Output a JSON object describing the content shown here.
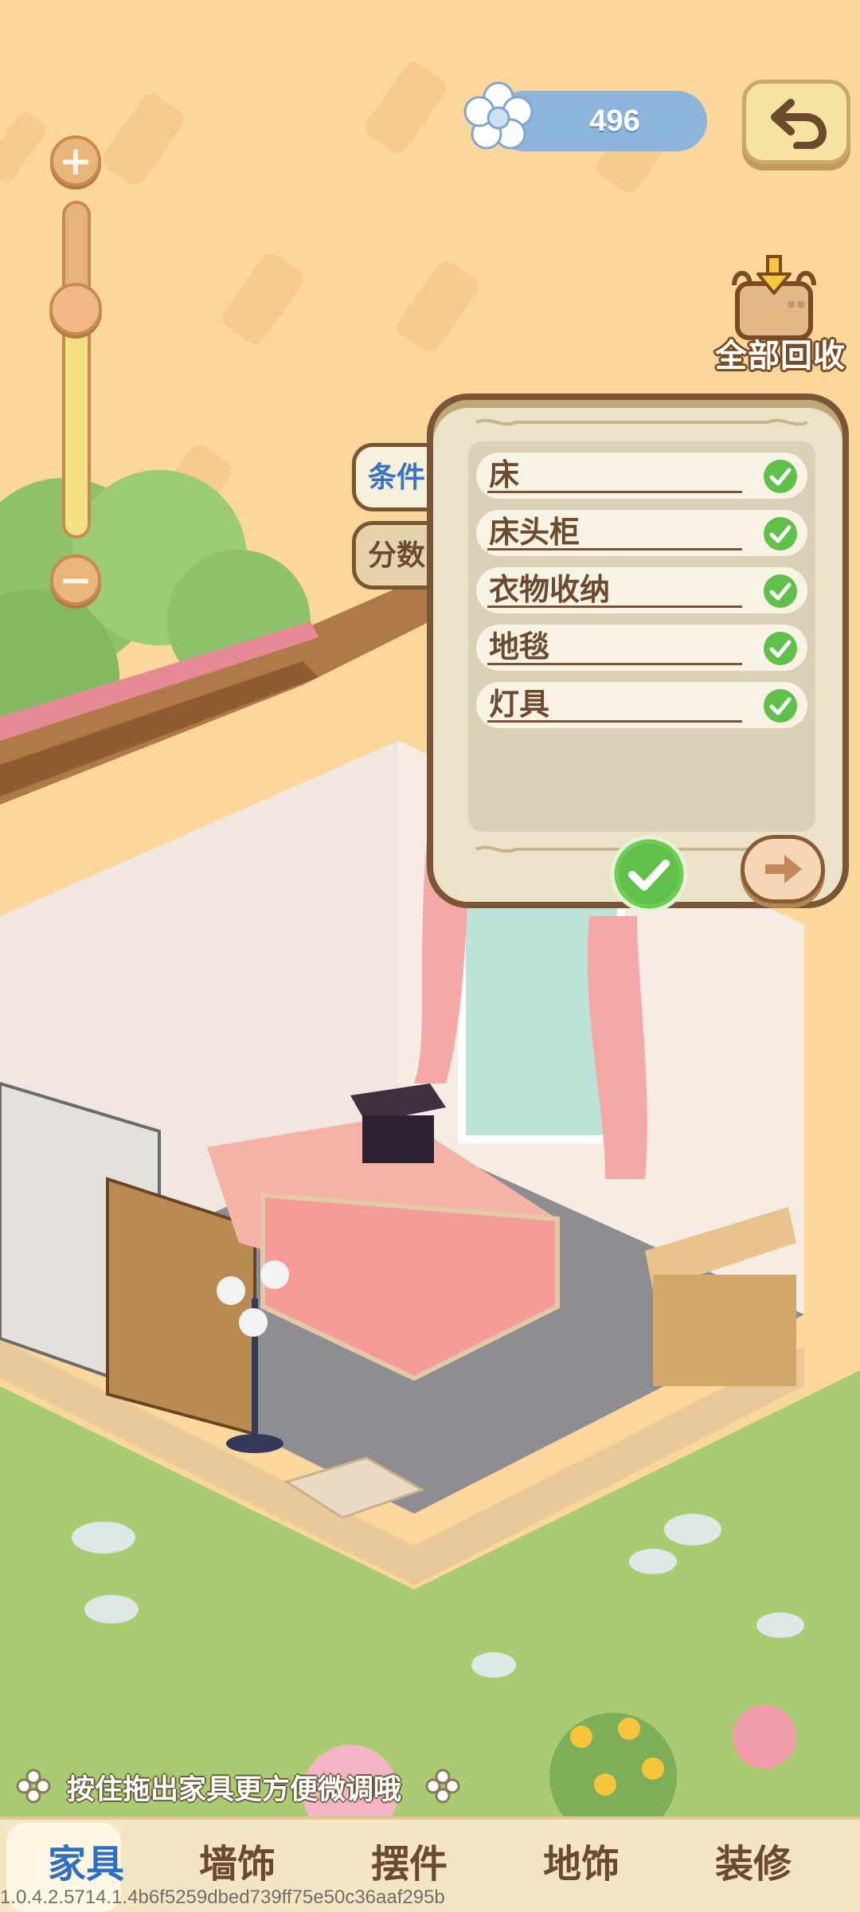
{
  "currency": {
    "value": "496",
    "icon": "flower-icon"
  },
  "recycle": {
    "label": "全部回收",
    "icon": "recycle-basket-icon"
  },
  "zoom": {
    "plus": "+",
    "minus": "−",
    "level": 0.68
  },
  "side_tabs": [
    {
      "label": "条件",
      "active": true
    },
    {
      "label": "分数",
      "active": false
    }
  ],
  "conditions": [
    {
      "label": "床",
      "done": true
    },
    {
      "label": "床头柜",
      "done": true
    },
    {
      "label": "衣物收纳",
      "done": true
    },
    {
      "label": "地毯",
      "done": true
    },
    {
      "label": "灯具",
      "done": true
    }
  ],
  "hint": {
    "text": "按住拖出家具更方便微调哦"
  },
  "bottom_nav": [
    {
      "label": "家具",
      "active": true
    },
    {
      "label": "墙饰",
      "active": false
    },
    {
      "label": "摆件",
      "active": false
    },
    {
      "label": "地饰",
      "active": false
    },
    {
      "label": "装修",
      "active": false
    }
  ],
  "build": "1.0.4.2.5714.1.4b6f5259dbed739ff75e50c36aaf295b",
  "colors": {
    "accent": "#2f6fc2",
    "check": "#5fc04a",
    "brown": "#7a5636"
  }
}
